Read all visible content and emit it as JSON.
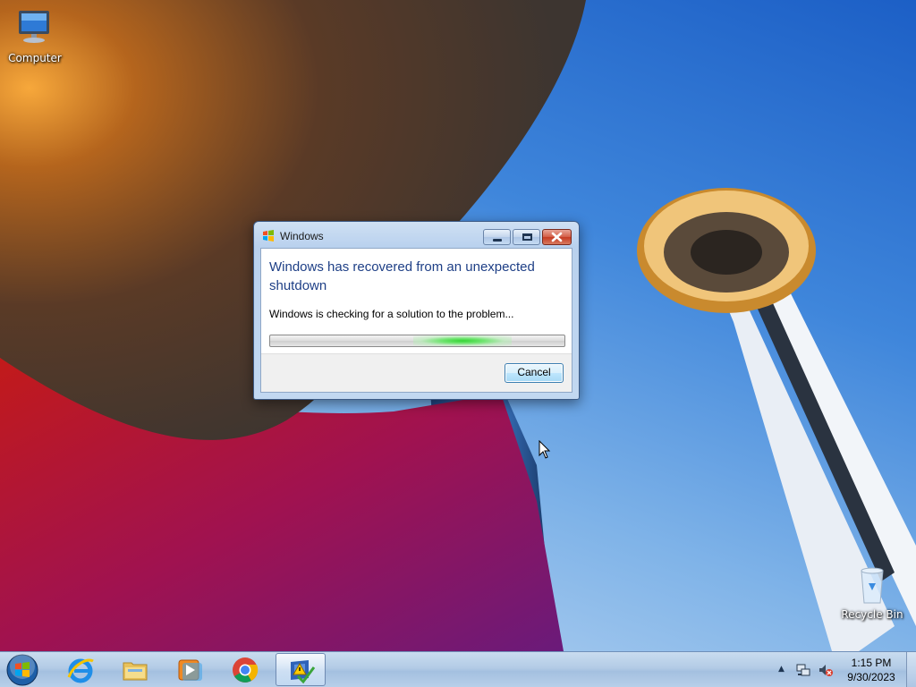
{
  "desktop": {
    "icons": [
      {
        "label": "Computer",
        "icon": "computer-icon"
      },
      {
        "label": "Recycle Bin",
        "icon": "recycle-bin-icon"
      }
    ]
  },
  "dialog": {
    "title": "Windows",
    "main_instruction": "Windows has recovered from an unexpected shutdown",
    "content": "Windows is checking for a solution to the problem...",
    "progress_style": "marquee",
    "cancel_label": "Cancel",
    "caption_buttons": [
      "minimize",
      "maximize",
      "close"
    ]
  },
  "taskbar": {
    "start": "start-orb-icon",
    "pinned": [
      {
        "name": "Internet Explorer",
        "icon": "internet-explorer-icon"
      },
      {
        "name": "Windows Explorer",
        "icon": "folder-icon"
      },
      {
        "name": "Windows Media Player",
        "icon": "media-player-icon"
      },
      {
        "name": "Google Chrome",
        "icon": "chrome-icon"
      },
      {
        "name": "Action Center",
        "icon": "action-center-flag-icon",
        "active": true
      }
    ],
    "tray": {
      "icons": [
        "show-hidden-icons-arrow",
        "network-icon",
        "volume-muted-icon"
      ],
      "time": "1:15 PM",
      "date": "9/30/2023"
    }
  },
  "colors": {
    "dialog_instruction": "#1e3f86",
    "progress_marquee": "#33d433",
    "close_button": "#c63a22"
  }
}
